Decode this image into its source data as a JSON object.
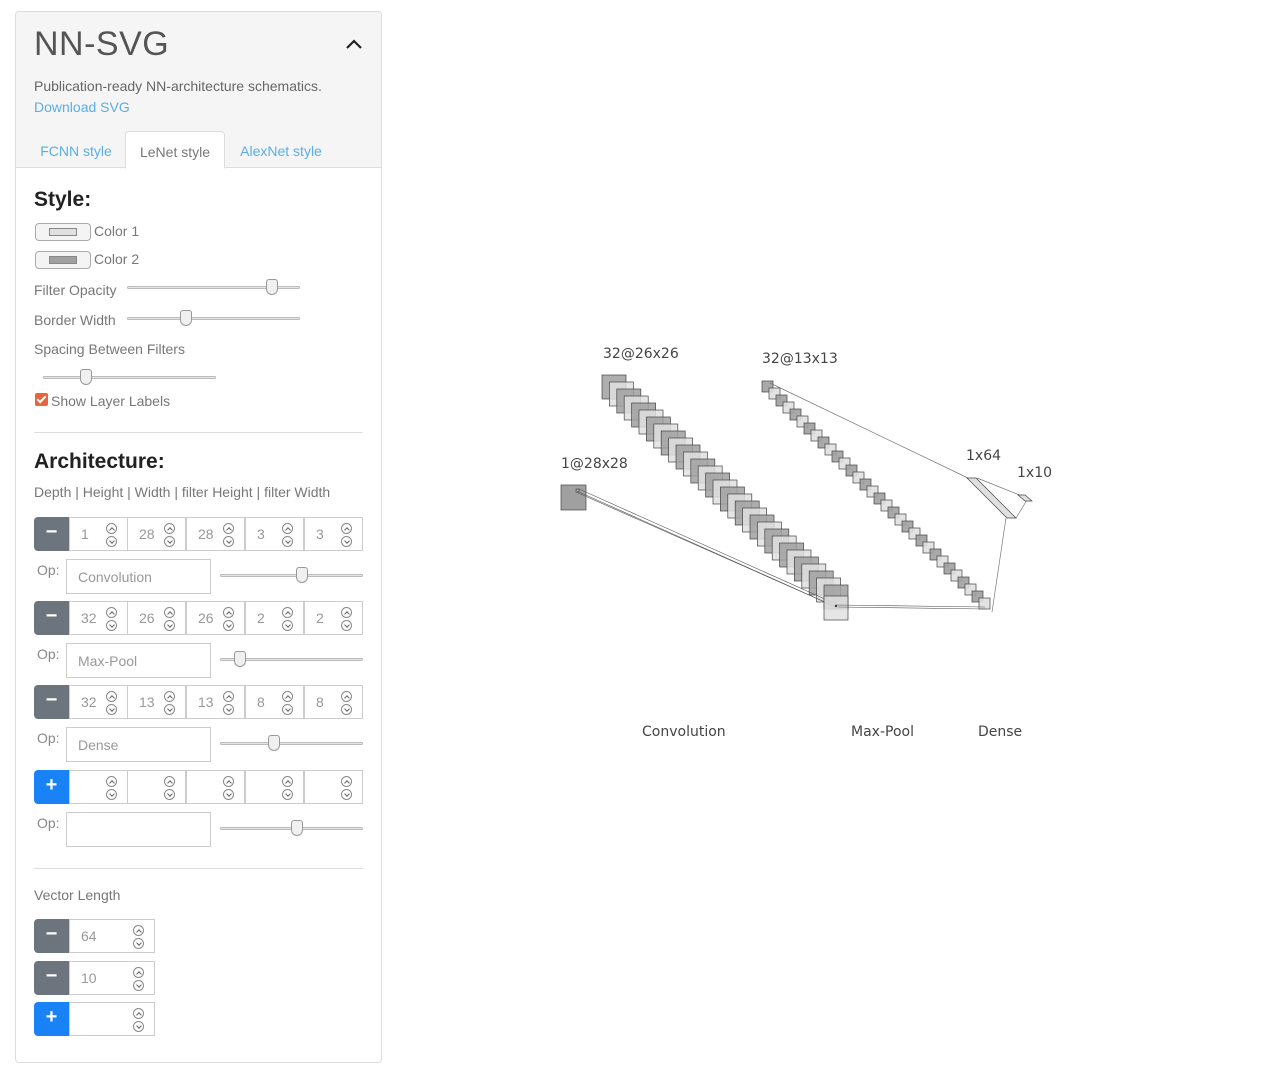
{
  "app": {
    "title": "NN-SVG",
    "subtitle": "Publication-ready NN-architecture schematics.",
    "download_label": "Download SVG"
  },
  "tabs": [
    {
      "label": "FCNN style",
      "active": false
    },
    {
      "label": "LeNet style",
      "active": true
    },
    {
      "label": "AlexNet style",
      "active": false
    }
  ],
  "style": {
    "heading": "Style:",
    "color1_label": "Color 1",
    "color1": "#e0e0e0",
    "color2_label": "Color 2",
    "color2": "#a0a0a0",
    "filter_opacity_label": "Filter Opacity",
    "filter_opacity_value": 0.85,
    "border_width_label": "Border Width",
    "border_width_value": 0.34,
    "spacing_label": "Spacing Between Filters",
    "spacing_value": 0.25,
    "show_labels_label": "Show Layer Labels",
    "show_labels": true
  },
  "architecture": {
    "heading": "Architecture:",
    "columns_label": "Depth | Height | Width | filter Height | filter Width",
    "op_label": "Op:",
    "layers": [
      {
        "values": [
          "1",
          "28",
          "28",
          "3",
          "3"
        ],
        "op": "Convolution",
        "op_slider": 0.57
      },
      {
        "values": [
          "32",
          "26",
          "26",
          "2",
          "2"
        ],
        "op": "Max-Pool",
        "op_slider": 0.14
      },
      {
        "values": [
          "32",
          "13",
          "13",
          "8",
          "8"
        ],
        "op": "Dense",
        "op_slider": 0.38
      },
      {
        "values": [
          "",
          "",
          "",
          "",
          ""
        ],
        "op": "",
        "op_slider": 0.54
      }
    ]
  },
  "vector": {
    "heading": "Vector Length",
    "values": [
      "64",
      "10",
      ""
    ]
  },
  "diagram": {
    "layer_labels": [
      "1@28x28",
      "32@26x26",
      "32@13x13",
      "1x64",
      "1x10"
    ],
    "op_labels": [
      "Convolution",
      "Max-Pool",
      "Dense"
    ],
    "conv_color": "#e0e0e0",
    "alt_color": "#a0a0a0"
  }
}
